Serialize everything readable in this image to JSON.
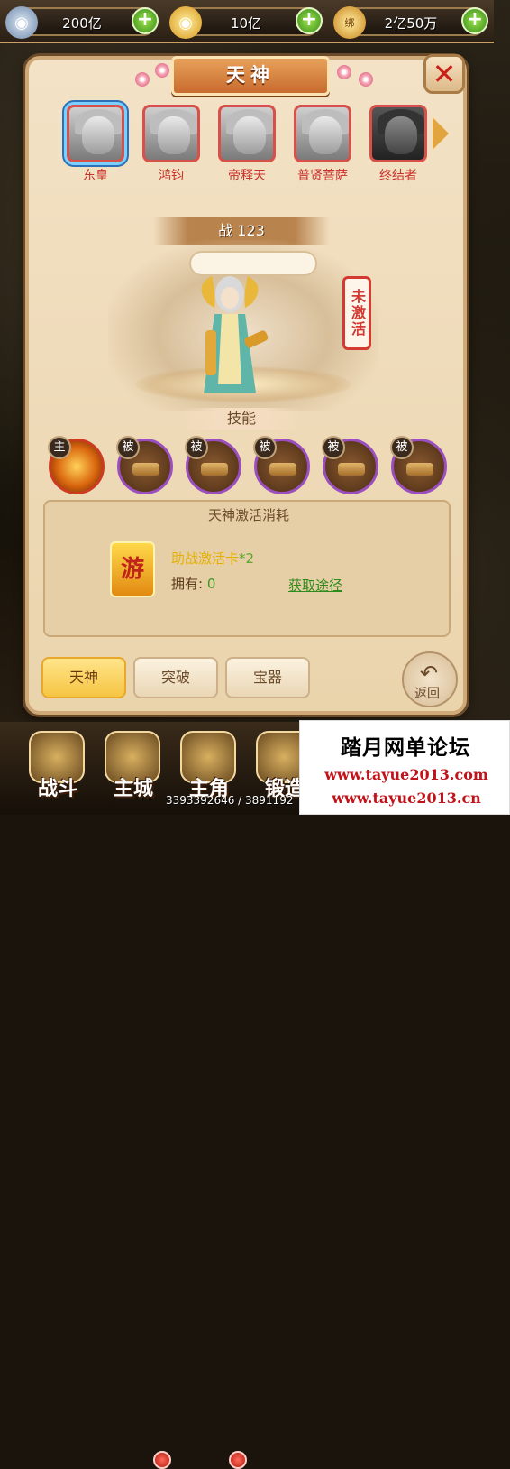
{
  "currency": {
    "silver": "200亿",
    "gold": "10亿",
    "bound_gold": "2亿50万",
    "bound_tag": "绑"
  },
  "panel": {
    "title": "天神",
    "close_glyph": "✕"
  },
  "heroes": [
    {
      "name": "东皇"
    },
    {
      "name": "鸿钧"
    },
    {
      "name": "帝释天"
    },
    {
      "name": "普贤菩萨"
    },
    {
      "name": "终结者"
    }
  ],
  "power": {
    "label": "战",
    "value": "123"
  },
  "status": "未激活",
  "skills_label": "技能",
  "skills": [
    {
      "type": "主"
    },
    {
      "type": "被"
    },
    {
      "type": "被"
    },
    {
      "type": "被"
    },
    {
      "type": "被"
    },
    {
      "type": "被"
    }
  ],
  "cost": {
    "title": "天神激活消耗",
    "card_glyph": "游",
    "item_name": "助战激活卡",
    "item_count": "*2",
    "owned_label": "拥有:",
    "owned_value": "0",
    "acquire_link": "获取途径"
  },
  "tabs": [
    {
      "label": "天神",
      "active": true
    },
    {
      "label": "突破",
      "active": false
    },
    {
      "label": "宝器",
      "active": false
    }
  ],
  "back_label": "返回",
  "bottom_nav": [
    {
      "label": "战斗"
    },
    {
      "label": "主城"
    },
    {
      "label": "主角"
    },
    {
      "label": "锻造"
    }
  ],
  "coords_text": "3393392646 / 3891192",
  "watermark": {
    "title": "踏月网单论坛",
    "url1": "www.tayue2013.com",
    "url2": "www.tayue2013.cn"
  }
}
